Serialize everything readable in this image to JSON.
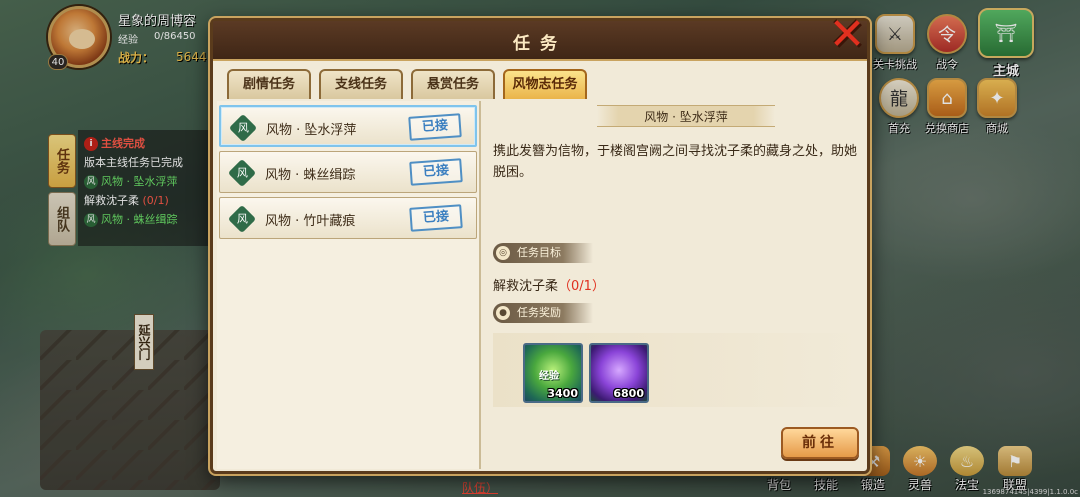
{
  "player": {
    "level": "40",
    "name": "星象的周博容",
    "exp_label": "经验",
    "exp_value": "0/86450",
    "power_label": "战力：",
    "power_value": "5644"
  },
  "tracker": {
    "tab_quest": "任务",
    "tab_team": "组队",
    "lines": [
      {
        "text": "主线完成"
      },
      {
        "text": "版本主线任务已完成"
      },
      {
        "text": "风物 · 坠水浮萍"
      },
      {
        "text": "解救沈子柔",
        "count": "(0/1)"
      },
      {
        "text": "风物 · 蛛丝缉踪"
      }
    ]
  },
  "map": {
    "gate_label": "延兴门",
    "team_link": "队伍）"
  },
  "right_buttons": {
    "stage_challenge": "关卡挑战",
    "battle_pass": "战令",
    "main_city": "主城",
    "first_recharge": "首充",
    "exchange_shop": "兑换商店",
    "shop": "商城"
  },
  "bottom_buttons": {
    "bag": "背包",
    "skills": "技能",
    "forge": "锻造",
    "spirit_beast": "灵兽",
    "treasure": "法宝",
    "alliance": "联盟"
  },
  "version_text": "1369874145|4399|1.1.0.0c",
  "dialog": {
    "title": "任务",
    "tabs": [
      "剧情任务",
      "支线任务",
      "悬赏任务",
      "风物志任务"
    ],
    "active_tab": 3,
    "quests": [
      {
        "icon": "风",
        "name": "风物 · 坠水浮萍",
        "status": "已接"
      },
      {
        "icon": "风",
        "name": "风物 · 蛛丝缉踪",
        "status": "已接"
      },
      {
        "icon": "风",
        "name": "风物 · 竹叶藏痕",
        "status": "已接"
      }
    ],
    "detail": {
      "title": "风物 · 坠水浮萍",
      "description": "携此发簪为信物，于楼阁宫阙之间寻找沈子柔的藏身之处，助她脱困。",
      "objective_header": "任务目标",
      "objective_text": "解救沈子柔",
      "objective_count": "（0/1）",
      "reward_header": "任务奖励",
      "rewards": [
        {
          "tag": "经验",
          "qty": "3400",
          "color": "#4aa83e"
        },
        {
          "qty": "6800",
          "color": "#8a44d8"
        }
      ],
      "go_button": "前往"
    }
  }
}
